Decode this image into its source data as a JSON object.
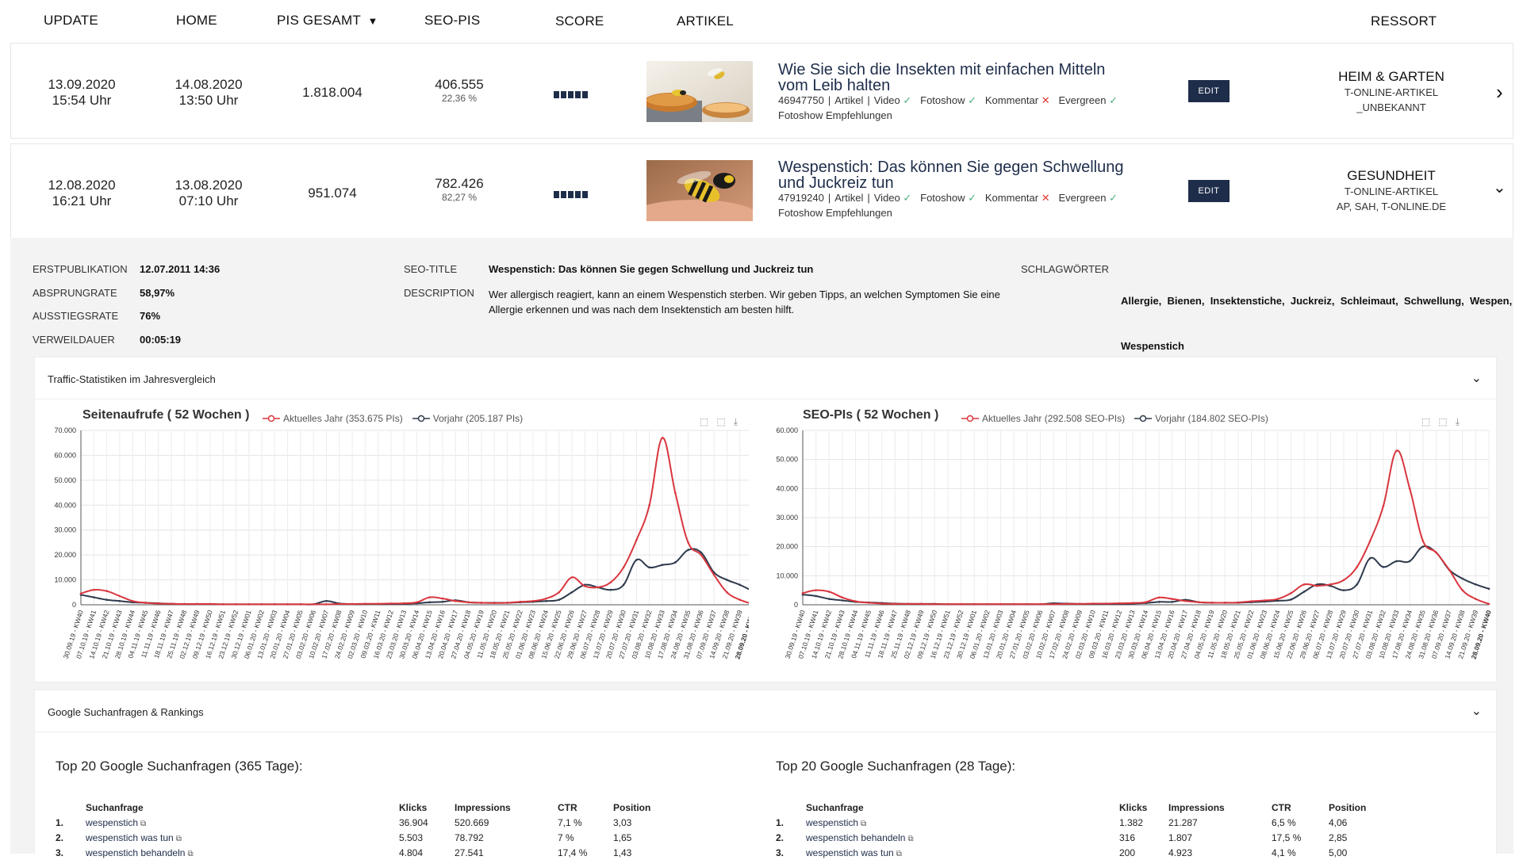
{
  "header": {
    "update": "UPDATE",
    "home": "HOME",
    "pis_gesamt": "PIS GESAMT",
    "sort_arrow": "▼",
    "seo_pis": "SEO-PIS",
    "score": "SCORE",
    "artikel": "ARTIKEL",
    "ressort": "RESSORT"
  },
  "rows": [
    {
      "update_date": "13.09.2020",
      "update_time": "15:54 Uhr",
      "home_date": "14.08.2020",
      "home_time": "13:50 Uhr",
      "pis": "1.818.004",
      "seo_pis": "406.555",
      "seo_pct": "22,36 %",
      "title_line1": "Wie Sie sich die Insekten mit einfachen Mitteln",
      "title_line2": "vom Leib halten",
      "id": "46947750",
      "type": "Artikel",
      "video": "Video",
      "fotoshow": "Fotoshow",
      "kommentar": "Kommentar",
      "evergreen": "Evergreen",
      "sub": "Fotoshow Empfehlungen",
      "edit": "EDIT",
      "ressort": "HEIM & GARTEN",
      "ressort_sub1": "T-ONLINE-ARTIKEL",
      "ressort_sub2": "_UNBEKANNT"
    },
    {
      "update_date": "12.08.2020",
      "update_time": "16:21 Uhr",
      "home_date": "13.08.2020",
      "home_time": "07:10 Uhr",
      "pis": "951.074",
      "seo_pis": "782.426",
      "seo_pct": "82,27 %",
      "title_line1": "Wespenstich: Das können Sie gegen Schwellung",
      "title_line2": "und Juckreiz tun",
      "id": "47919240",
      "type": "Artikel",
      "video": "Video",
      "fotoshow": "Fotoshow",
      "kommentar": "Kommentar",
      "evergreen": "Evergreen",
      "sub": "Fotoshow Empfehlungen",
      "edit": "EDIT",
      "ressort": "GESUNDHEIT",
      "ressort_sub1": "T-ONLINE-ARTIKEL",
      "ressort_sub2": "AP, SAH, T-ONLINE.DE"
    }
  ],
  "details": {
    "erstpublikation_k": "ERSTPUBLIKATION",
    "erstpublikation_v": "12.07.2011 14:36",
    "absprungrate_k": "ABSPRUNGRATE",
    "absprungrate_v": "58,97%",
    "ausstiegsrate_k": "AUSSTIEGSRATE",
    "ausstiegsrate_v": "76%",
    "verweildauer_k": "VERWEILDAUER",
    "verweildauer_v": "00:05:19",
    "seo_title_k": "SEO-TITLE",
    "seo_title_v": "Wespenstich: Das können Sie gegen Schwellung und Juckreiz tun",
    "description_k": "DESCRIPTION",
    "description_v1": "Wer allergisch reagiert, kann an einem Wespenstich sterben. Wir geben Tipps, an welchen Symptomen Sie eine",
    "description_v2": "Allergie erkennen und was nach dem Insektenstich am besten hilft.",
    "schlagwoerter_k": "SCHLAGWÖRTER",
    "schlagwoerter_v1": "Allergie,  Bienen,  Insektenstiche,  Juckreiz,  Schleimaut,  Schwellung,  Wespen,",
    "schlagwoerter_v2": "Wespenstich"
  },
  "traffic_panel": {
    "title": "Traffic-Statistiken im Jahresvergleich"
  },
  "google_panel": {
    "title": "Google Suchanfragen & Rankings"
  },
  "chart_data": [
    {
      "type": "line",
      "title": "Seitenaufrufe ( 52 Wochen )",
      "legend_position": "top",
      "ylim": [
        0,
        70000
      ],
      "yticks": [
        "0",
        "10.000",
        "20.000",
        "30.000",
        "40.000",
        "50.000",
        "60.000",
        "70.000"
      ],
      "x": [
        "30.09.19 - KW40",
        "07.10.19 - KW41",
        "14.10.19 - KW42",
        "21.10.19 - KW43",
        "28.10.19 - KW44",
        "04.11.19 - KW45",
        "11.11.19 - KW46",
        "18.11.19 - KW47",
        "25.11.19 - KW48",
        "02.12.19 - KW49",
        "09.12.19 - KW50",
        "16.12.19 - KW51",
        "23.12.19 - KW52",
        "30.12.19 - KW01",
        "06.01.20 - KW02",
        "13.01.20 - KW03",
        "20.01.20 - KW04",
        "27.01.20 - KW05",
        "03.02.20 - KW06",
        "10.02.20 - KW07",
        "17.02.20 - KW08",
        "24.02.20 - KW09",
        "02.03.20 - KW10",
        "09.03.20 - KW11",
        "16.03.20 - KW12",
        "23.03.20 - KW13",
        "30.03.20 - KW14",
        "06.04.20 - KW15",
        "13.04.20 - KW16",
        "20.04.20 - KW17",
        "27.04.20 - KW18",
        "04.05.20 - KW19",
        "11.05.20 - KW20",
        "18.05.20 - KW21",
        "25.05.20 - KW22",
        "01.06.20 - KW23",
        "08.06.20 - KW24",
        "15.06.20 - KW25",
        "22.06.20 - KW26",
        "29.06.20 - KW27",
        "06.07.20 - KW28",
        "13.07.20 - KW29",
        "20.07.20 - KW30",
        "27.07.20 - KW31",
        "03.08.20 - KW32",
        "10.08.20 - KW33",
        "17.08.20 - KW34",
        "24.08.20 - KW35",
        "31.08.20 - KW36",
        "07.09.20 - KW37",
        "14.09.20 - KW38",
        "21.09.20 - KW39",
        "28.09.20 - KW40"
      ],
      "series": [
        {
          "name": "Aktuelles Jahr (353.675 PIs)",
          "color": "#d9363e",
          "values": [
            4500,
            6000,
            5500,
            3500,
            1500,
            800,
            500,
            400,
            300,
            300,
            300,
            200,
            200,
            200,
            200,
            200,
            200,
            200,
            200,
            200,
            300,
            300,
            400,
            400,
            500,
            600,
            1000,
            3000,
            2500,
            1500,
            1000,
            800,
            700,
            800,
            1200,
            1500,
            2500,
            5000,
            11000,
            7500,
            7000,
            9000,
            15000,
            26000,
            40000,
            67000,
            45000,
            25000,
            20000,
            12000,
            5000,
            2000,
            300
          ]
        },
        {
          "name": "Vorjahr (205.187 PIs)",
          "color": "#2e3a4d",
          "values": [
            4000,
            3000,
            2000,
            1500,
            1000,
            800,
            600,
            400,
            300,
            300,
            300,
            200,
            200,
            200,
            200,
            200,
            200,
            200,
            200,
            1500,
            500,
            300,
            300,
            300,
            300,
            400,
            600,
            1000,
            1200,
            1800,
            1000,
            800,
            800,
            800,
            1000,
            1200,
            1500,
            2000,
            5000,
            8000,
            7000,
            6000,
            8000,
            18000,
            15000,
            16000,
            17000,
            22000,
            21000,
            13000,
            10000,
            8000,
            5500
          ]
        }
      ]
    },
    {
      "type": "line",
      "title": "SEO-PIs ( 52 Wochen )",
      "legend_position": "top",
      "ylim": [
        0,
        60000
      ],
      "yticks": [
        "0",
        "10.000",
        "20.000",
        "30.000",
        "40.000",
        "50.000",
        "60.000"
      ],
      "x": [
        "30.09.19 - KW40",
        "07.10.19 - KW41",
        "14.10.19 - KW42",
        "21.10.19 - KW43",
        "28.10.19 - KW44",
        "04.11.19 - KW45",
        "11.11.19 - KW46",
        "18.11.19 - KW47",
        "25.11.19 - KW48",
        "02.12.19 - KW49",
        "09.12.19 - KW50",
        "16.12.19 - KW51",
        "23.12.19 - KW52",
        "30.12.19 - KW01",
        "06.01.20 - KW02",
        "13.01.20 - KW03",
        "20.01.20 - KW04",
        "27.01.20 - KW05",
        "03.02.20 - KW06",
        "10.02.20 - KW07",
        "17.02.20 - KW08",
        "24.02.20 - KW09",
        "02.03.20 - KW10",
        "09.03.20 - KW11",
        "16.03.20 - KW12",
        "23.03.20 - KW13",
        "30.03.20 - KW14",
        "06.04.20 - KW15",
        "13.04.20 - KW16",
        "20.04.20 - KW17",
        "27.04.20 - KW18",
        "04.05.20 - KW19",
        "11.05.20 - KW20",
        "18.05.20 - KW21",
        "25.05.20 - KW22",
        "01.06.20 - KW23",
        "08.06.20 - KW24",
        "15.06.20 - KW25",
        "22.06.20 - KW26",
        "29.06.20 - KW27",
        "06.07.20 - KW28",
        "13.07.20 - KW29",
        "20.07.20 - KW30",
        "27.07.20 - KW31",
        "03.08.20 - KW32",
        "10.08.20 - KW33",
        "17.08.20 - KW34",
        "24.08.20 - KW35",
        "31.08.20 - KW36",
        "07.09.20 - KW37",
        "14.09.20 - KW38",
        "21.09.20 - KW39",
        "28.09.20 - KW40"
      ],
      "series": [
        {
          "name": "Aktuelles Jahr (292.508 SEO-PIs)",
          "color": "#d9363e",
          "values": [
            4000,
            5000,
            4500,
            2500,
            1200,
            700,
            400,
            300,
            300,
            300,
            200,
            200,
            200,
            200,
            200,
            200,
            200,
            200,
            200,
            200,
            300,
            300,
            400,
            400,
            500,
            600,
            900,
            2500,
            2000,
            1300,
            900,
            700,
            700,
            800,
            1200,
            1500,
            2000,
            4000,
            7000,
            6500,
            7000,
            8500,
            13000,
            22000,
            34000,
            53000,
            40000,
            22000,
            18000,
            12000,
            5000,
            2000,
            300
          ]
        },
        {
          "name": "Vorjahr (184.802 SEO-PIs)",
          "color": "#2e3a4d",
          "values": [
            3500,
            3000,
            2000,
            1500,
            1000,
            800,
            600,
            400,
            300,
            300,
            300,
            200,
            200,
            200,
            200,
            200,
            200,
            200,
            200,
            500,
            400,
            300,
            300,
            300,
            300,
            400,
            600,
            1000,
            1000,
            1700,
            900,
            700,
            700,
            700,
            900,
            1100,
            1400,
            1800,
            4500,
            7000,
            6500,
            5000,
            7000,
            16000,
            13000,
            15000,
            15000,
            20000,
            18000,
            12000,
            9000,
            7000,
            5500
          ]
        }
      ]
    }
  ],
  "queries_365": {
    "title": "Top 20 Google Suchanfragen (365 Tage):",
    "headers": [
      "Suchanfrage",
      "Klicks",
      "Impressions",
      "CTR",
      "Position"
    ],
    "rows": [
      [
        "1.",
        "wespenstich",
        "36.904",
        "520.669",
        "7,1 %",
        "3,03"
      ],
      [
        "2.",
        "wespenstich was tun",
        "5.503",
        "78.792",
        "7 %",
        "1,65"
      ],
      [
        "3.",
        "wespenstich behandeln",
        "4.804",
        "27.541",
        "17,4 %",
        "1,43"
      ]
    ]
  },
  "queries_28": {
    "title": "Top 20 Google Suchanfragen (28 Tage):",
    "headers": [
      "Suchanfrage",
      "Klicks",
      "Impressions",
      "CTR",
      "Position"
    ],
    "rows": [
      [
        "1.",
        "wespenstich",
        "1.382",
        "21.287",
        "6,5 %",
        "4,06"
      ],
      [
        "2.",
        "wespenstich behandeln",
        "316",
        "1.807",
        "17,5 %",
        "2,85"
      ],
      [
        "3.",
        "wespenstich was tun",
        "200",
        "4.923",
        "4,1 %",
        "5,00"
      ]
    ]
  },
  "icons": {
    "check": "✓",
    "cross": "✕",
    "chevron_right": "›",
    "chevron_down": "⌄",
    "external": "⧉"
  }
}
